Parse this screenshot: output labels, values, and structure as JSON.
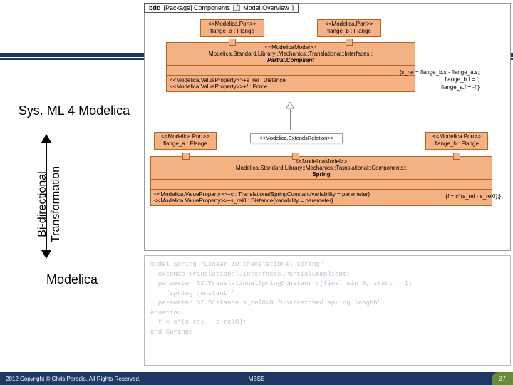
{
  "bars": {},
  "left": {
    "top_title": "Sys. ML 4 Modelica",
    "rotated1": "Bi-directional",
    "rotated2": "Transformation",
    "bottom_title": "Modelica"
  },
  "footer": {
    "copyright": "2012 Copyright © Chris Paredis. All Rights Reserved.",
    "center": "MBSE",
    "page": "37"
  },
  "diagram": {
    "header_bdd": "bdd",
    "header_pkg": "[Package] Components",
    "header_model": "Model.Overview",
    "port_a_top": {
      "stereo": "<<Modelica.Port>>",
      "label": "flange_a : Flange"
    },
    "port_b_top": {
      "stereo": "<<Modelica.Port>>",
      "label": "flange_b : Flange"
    },
    "partial": {
      "stereo": "<<ModelicaModel>>",
      "path": "Modelica.Standard.Library::Mechanics::Translational::Interfaces::",
      "name": "Partial.Compliant",
      "eq1": "{s_rel = flange_b.s - flange_a.s;",
      "eq2": "flange_b.f = f;",
      "eq3": "flange_a.f = -f;}"
    },
    "vp_top": {
      "l1": "<<Modelica.ValueProperty>>+s_rel : Distance",
      "l2": "<<Modelica.ValueProperty>>+f : Force"
    },
    "port_a_bot": {
      "stereo": "<<Modelica.Port>>",
      "label": "flange_a : Flange"
    },
    "ext_rel": {
      "stereo": "<<Modelica.ExtendsRelation>>"
    },
    "port_b_bot": {
      "stereo": "<<Modelica.Port>>",
      "label": "flange_b : Flange"
    },
    "spring": {
      "stereo": "<<ModelicaModel>>",
      "path": "Modelica.Standard.Library::Mechanics::Translational::Components::",
      "name": "Spring",
      "eq": "{f = c*(s_rel - s_rel0);}"
    },
    "vp_bot": {
      "l1": "<<Modelica.ValueProperty>>+c : TranslationalSpringConstant{variability = parameter}",
      "l2": "<<Modelica.ValueProperty>>+s_rel0 : Distance{variability = parameter}"
    }
  },
  "code": {
    "l1": "model Spring \"Linear 1D translational spring\"",
    "l2": "  extends Translational.Interfaces.PartialCompliant;",
    "l3": "  parameter SI.TranslationalSpringConstant c(final min=0, start = 1)",
    "l4": "    \"spring constant \";",
    "l5": "  parameter SI.Distance s_rel0=0 \"unstretched spring length\";",
    "l6": "",
    "l7": "equation",
    "l8": "  f = c*(s_rel - s_rel0);",
    "l9": "end Spring;"
  }
}
